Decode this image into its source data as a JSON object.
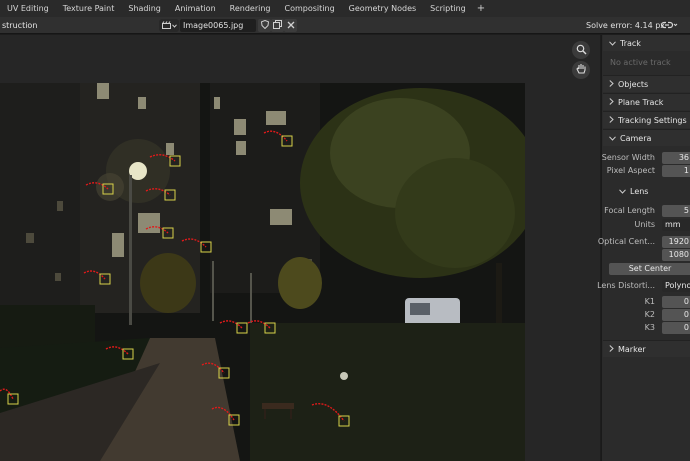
{
  "workspace_tabs": [
    "UV Editing",
    "Texture Paint",
    "Shading",
    "Animation",
    "Rendering",
    "Compositing",
    "Geometry Nodes",
    "Scripting"
  ],
  "workspace_add": "+",
  "header": {
    "mode_label": "struction",
    "clip_name": "Image0065.jpg",
    "solve_error": "Solve error: 4.14 px"
  },
  "panel": {
    "track": {
      "title": "Track",
      "empty_text": "No active track"
    },
    "objects": {
      "title": "Objects"
    },
    "plane_track": {
      "title": "Plane Track"
    },
    "tracking_settings": {
      "title": "Tracking Settings"
    },
    "camera": {
      "title": "Camera",
      "sensor_width_label": "Sensor Width",
      "sensor_width_value": "36",
      "pixel_aspect_label": "Pixel Aspect",
      "pixel_aspect_value": "1",
      "lens": {
        "title": "Lens",
        "focal_length_label": "Focal Length",
        "focal_length_value": "5",
        "units_label": "Units",
        "units_value": "mm",
        "optical_center_label": "Optical Cent...",
        "optical_center_x": "1920",
        "optical_center_y": "1080",
        "set_center_label": "Set Center",
        "lens_distortion_label": "Lens Distorti...",
        "lens_distortion_value": "Polynom",
        "k1_label": "K1",
        "k1_value": "0",
        "k2_label": "K2",
        "k2_value": "0",
        "k3_label": "K3",
        "k3_value": "0"
      }
    },
    "marker": {
      "title": "Marker"
    }
  },
  "icons": {
    "clip": "movie-clip-icon",
    "shield": "fake-user-shield-icon",
    "copy": "duplicate-icon",
    "close": "close-icon",
    "link": "link-icon",
    "zoom": "zoom-icon",
    "pan": "hand-pan-icon"
  },
  "colors": {
    "marker_path": "#e01a1a",
    "marker_box": "#d8d24a",
    "panel_bg": "#2b2b2b"
  }
}
